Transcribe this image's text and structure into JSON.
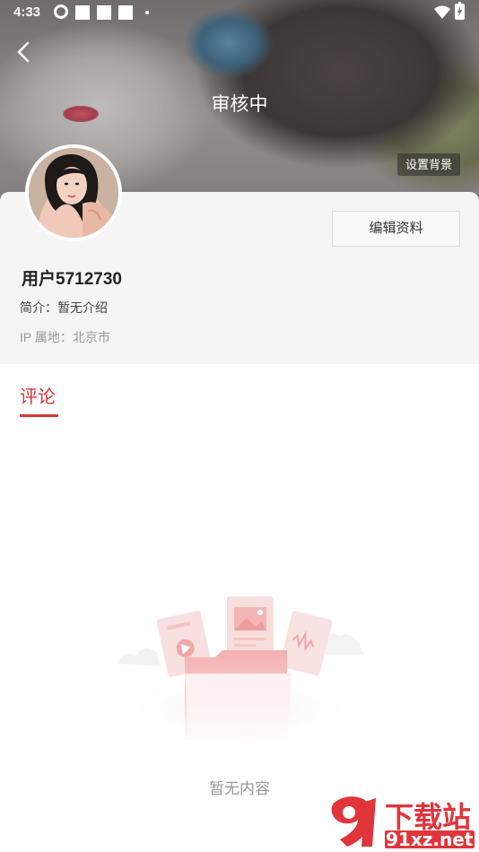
{
  "status_bar": {
    "time": "4:33"
  },
  "header": {
    "title": "审核中",
    "set_background_label": "设置背景"
  },
  "profile": {
    "edit_label": "编辑资料",
    "username": "用户5712730",
    "bio": "简介：暂无介绍",
    "ip_location": "IP 属地：北京市"
  },
  "tabs": [
    {
      "label": "评论",
      "active": true
    }
  ],
  "empty_state": {
    "text": "暂无内容"
  },
  "watermark": {
    "text": "下载站",
    "sub": "91xz.net"
  },
  "colors": {
    "accent": "#d8353b",
    "card_bg": "#f5f5f5",
    "muted_text": "#999999"
  },
  "icons": [
    "back-icon",
    "wifi-icon",
    "battery-icon"
  ]
}
